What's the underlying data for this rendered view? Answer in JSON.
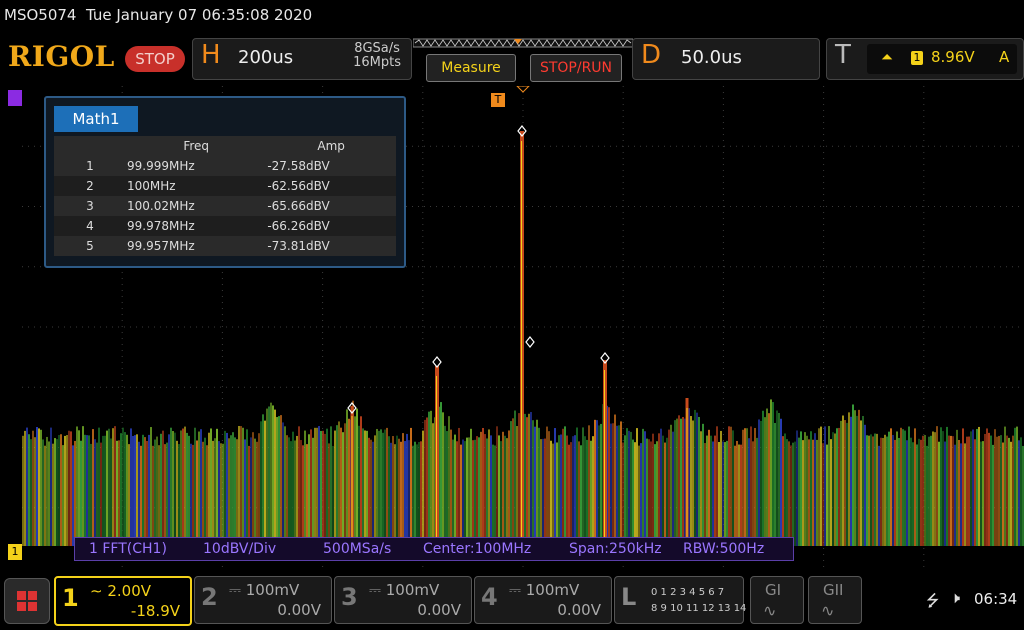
{
  "status": {
    "model": "MSO5074",
    "datetime": "Tue January 07 06:35:08 2020"
  },
  "topbar": {
    "logo": "RIGOL",
    "state": "STOP",
    "horizontal": {
      "letter": "H",
      "scale": "200us",
      "sample_rate": "8GSa/s",
      "memory_depth": "16Mpts"
    },
    "measure_label": "Measure",
    "stoprun_label": "STOP/RUN",
    "delay": {
      "letter": "D",
      "value": "50.0us"
    },
    "trigger": {
      "letter": "T",
      "source": "1",
      "level": "8.96V",
      "mode": "A"
    }
  },
  "math_panel": {
    "tab": "Math1",
    "columns": [
      "Freq",
      "Amp"
    ],
    "rows": [
      {
        "n": "1",
        "freq": "99.999MHz",
        "amp": "-27.58dBV"
      },
      {
        "n": "2",
        "freq": "100MHz",
        "amp": "-62.56dBV"
      },
      {
        "n": "3",
        "freq": "100.02MHz",
        "amp": "-65.66dBV"
      },
      {
        "n": "4",
        "freq": "99.978MHz",
        "amp": "-66.26dBV"
      },
      {
        "n": "5",
        "freq": "99.957MHz",
        "amp": "-73.81dBV"
      }
    ]
  },
  "fft_bar": {
    "source": "1 FFT(CH1)",
    "scale": "10dBV/Div",
    "rate": "500MSa/s",
    "center": "Center:100MHz",
    "span": "Span:250kHz",
    "rbw": "RBW:500Hz"
  },
  "markers": {
    "trigger": "T",
    "channel": "1"
  },
  "bottombar": {
    "ch1": {
      "num": "1",
      "scale": "2.00V",
      "offset": "-18.9V"
    },
    "ch2": {
      "num": "2",
      "scale": "100mV",
      "offset": "0.00V"
    },
    "ch3": {
      "num": "3",
      "scale": "100mV",
      "offset": "0.00V"
    },
    "ch4": {
      "num": "4",
      "scale": "100mV",
      "offset": "0.00V"
    },
    "logic": {
      "letter": "L",
      "row1": "0 1 2 3  4 5 6 7",
      "row2": "8 9 10 11  12 13 14 15"
    },
    "gen1": "GI",
    "gen2": "GII",
    "time": "06:34"
  },
  "colors": {
    "accent": "#f08a1c",
    "ch1": "#f4d21a",
    "math": "#8b2be2",
    "stop": "#c8302a"
  }
}
